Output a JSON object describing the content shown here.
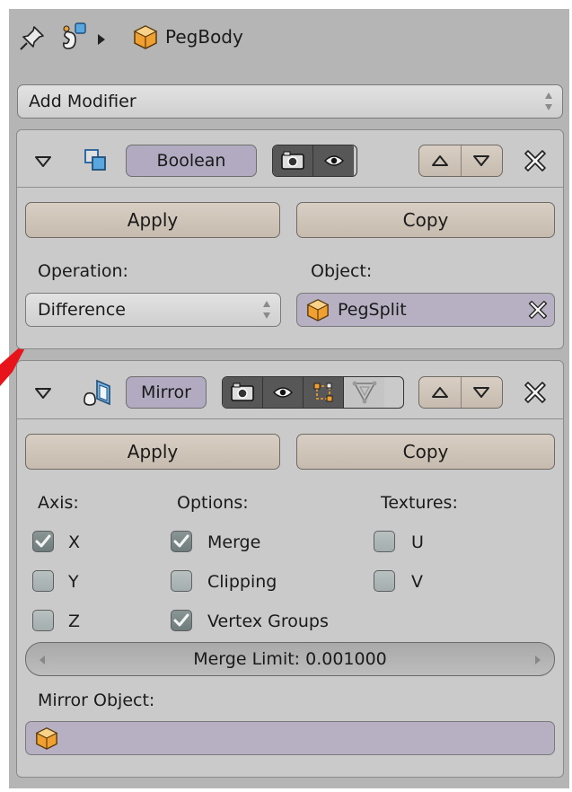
{
  "header": {
    "pin_icon": "pin-icon",
    "context_icon": "modifier-context-icon",
    "object_icon": "mesh-object-icon",
    "object_name": "PegBody"
  },
  "add_modifier": {
    "label": "Add Modifier"
  },
  "boolean": {
    "name": "Boolean",
    "icon": "boolean-modifier-icon",
    "apply_label": "Apply",
    "copy_label": "Copy",
    "operation_label": "Operation:",
    "operation_value": "Difference",
    "object_label": "Object:",
    "object_value": "PegSplit"
  },
  "mirror": {
    "name": "Mirror",
    "icon": "mirror-modifier-icon",
    "apply_label": "Apply",
    "copy_label": "Copy",
    "axis_label": "Axis:",
    "options_label": "Options:",
    "textures_label": "Textures:",
    "axis": [
      {
        "label": "X",
        "checked": true
      },
      {
        "label": "Y",
        "checked": false
      },
      {
        "label": "Z",
        "checked": false
      }
    ],
    "options": [
      {
        "label": "Merge",
        "checked": true
      },
      {
        "label": "Clipping",
        "checked": false
      },
      {
        "label": "Vertex Groups",
        "checked": true
      }
    ],
    "textures": [
      {
        "label": "U",
        "checked": false
      },
      {
        "label": "V",
        "checked": false
      }
    ],
    "merge_limit": "Merge Limit: 0.001000",
    "mirror_object_label": "Mirror Object:",
    "mirror_object_value": ""
  },
  "colors": {
    "panel_bg": "#b5b5b5",
    "box_bg": "#cacaca",
    "button_bg": "#d2c8bd",
    "object_field_bg": "#b7b0c3",
    "toggle_active": "#575757",
    "annotation_arrow": "#e8141c"
  }
}
